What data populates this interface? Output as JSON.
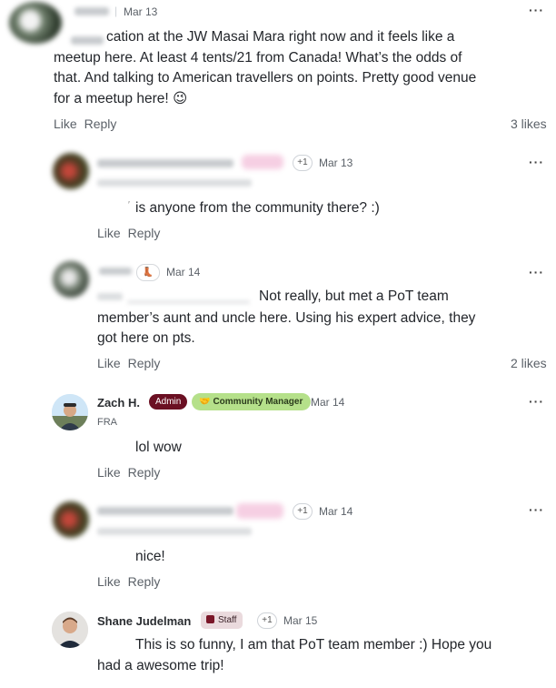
{
  "thread": {
    "comments": [
      {
        "date": "Mar 13",
        "text_visible": "cation at the JW Masai Mara right now and it feels like a",
        "text_line2": "meetup here. At least 4 tents/21 from Canada! What’s the odds of",
        "text_line3": "that. And talking to American travellers on points. Pretty good venue",
        "text_line4": "for a meetup here! 😉",
        "like_label": "Like",
        "reply_label": "Reply",
        "likes": "3 likes"
      },
      {
        "plus": "+1",
        "date": "Mar 13",
        "text": "is anyone from the community there? :)",
        "like_label": "Like",
        "reply_label": "Reply"
      },
      {
        "date": "Mar 14",
        "text_line1": "Not really, but met a PoT team",
        "text_line2": "member’s aunt and uncle here. Using his expert advice, they",
        "text_line3": "got here on pts.",
        "like_label": "Like",
        "reply_label": "Reply",
        "likes": "2 likes"
      },
      {
        "author": "Zach H.",
        "badge_admin": "Admin",
        "badge_role": "Community Manager",
        "date": "Mar 14",
        "location": "FRA",
        "text": "lol wow",
        "like_label": "Like",
        "reply_label": "Reply"
      },
      {
        "plus": "+1",
        "date": "Mar 14",
        "text": "nice!",
        "like_label": "Like",
        "reply_label": "Reply"
      },
      {
        "author": "Shane Judelman",
        "badge_staff": "Staff",
        "plus": "+1",
        "date": "Mar 15",
        "text_line1": "This is so funny, I am that PoT team member :) Hope you",
        "text_line2": "had a awesome trip!"
      }
    ],
    "more_label": "···"
  },
  "colors": {
    "admin_badge": "#6b1023",
    "community_manager_badge": "#b5e08a",
    "staff_badge": "#eadadd"
  }
}
